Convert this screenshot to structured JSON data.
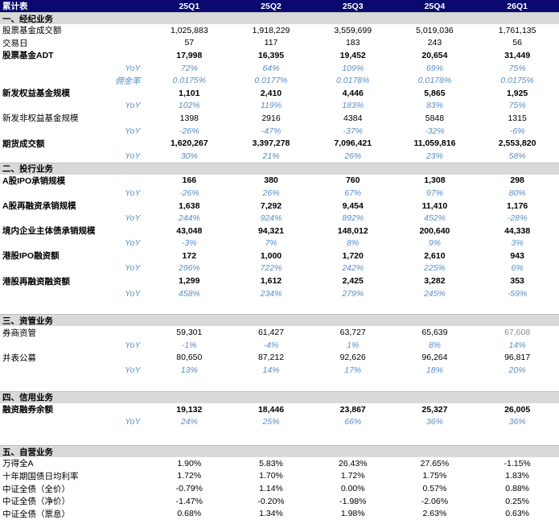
{
  "table": {
    "corner": "累计表",
    "quarters": [
      "25Q1",
      "25Q2",
      "25Q3",
      "25Q4",
      "26Q1"
    ]
  },
  "sections": [
    {
      "title": "一、经纪业务",
      "rows": [
        {
          "label": "股票基金成交额",
          "values": [
            "1,025,883",
            "1,918,229",
            "3,559,699",
            "5,019,036",
            "1,761,135"
          ],
          "style": "normal"
        },
        {
          "label": "交易日",
          "values": [
            "57",
            "117",
            "183",
            "243",
            "56"
          ],
          "style": "normal"
        },
        {
          "label": "股票基金ADT",
          "values": [
            "17,998",
            "16,395",
            "19,452",
            "20,654",
            "31,449"
          ],
          "style": "bold"
        },
        {
          "label": "YoY",
          "values": [
            "72%",
            "64%",
            "109%",
            "69%",
            "75%"
          ],
          "style": "sub"
        },
        {
          "label": "佣金率",
          "values": [
            "0.0175%",
            "0.0177%",
            "0.0178%",
            "0.0178%",
            "0.0175%"
          ],
          "style": "sub"
        },
        {
          "label": "新发权益基金规模",
          "values": [
            "1,101",
            "2,410",
            "4,446",
            "5,865",
            "1,925"
          ],
          "style": "bold"
        },
        {
          "label": "YoY",
          "values": [
            "102%",
            "119%",
            "183%",
            "83%",
            "75%"
          ],
          "style": "sub"
        },
        {
          "label": "新发非权益基金规模",
          "values": [
            "1398",
            "2916",
            "4384",
            "5848",
            "1315"
          ],
          "style": "normal"
        },
        {
          "label": "YoY",
          "values": [
            "-26%",
            "-47%",
            "-37%",
            "-32%",
            "-6%"
          ],
          "style": "sub"
        },
        {
          "label": "期货成交额",
          "values": [
            "1,620,267",
            "3,397,278",
            "7,096,421",
            "11,059,816",
            "2,553,820"
          ],
          "style": "bold"
        },
        {
          "label": "YoY",
          "values": [
            "30%",
            "21%",
            "26%",
            "23%",
            "58%"
          ],
          "style": "sub"
        }
      ]
    },
    {
      "title": "二、投行业务",
      "rows": [
        {
          "label": "A股IPO承销规模",
          "values": [
            "166",
            "380",
            "760",
            "1,308",
            "298"
          ],
          "style": "bold"
        },
        {
          "label": "YoY",
          "values": [
            "-26%",
            "26%",
            "67%",
            "97%",
            "80%"
          ],
          "style": "sub"
        },
        {
          "label": "A股再融资承销规模",
          "values": [
            "1,638",
            "7,292",
            "9,454",
            "11,410",
            "1,176"
          ],
          "style": "bold"
        },
        {
          "label": "YoY",
          "values": [
            "244%",
            "924%",
            "892%",
            "452%",
            "-28%"
          ],
          "style": "sub"
        },
        {
          "label": "境内企业主体债承销规模",
          "values": [
            "43,048",
            "94,321",
            "148,012",
            "200,640",
            "44,338"
          ],
          "style": "bold"
        },
        {
          "label": "YoY",
          "values": [
            "-3%",
            "7%",
            "8%",
            "9%",
            "3%"
          ],
          "style": "sub"
        },
        {
          "label": "港股IPO融资额",
          "values": [
            "172",
            "1,000",
            "1,720",
            "2,610",
            "943"
          ],
          "style": "bold"
        },
        {
          "label": "YoY",
          "values": [
            "296%",
            "722%",
            "242%",
            "225%",
            "6%"
          ],
          "style": "sub"
        },
        {
          "label": "港股再融资融资额",
          "values": [
            "1,299",
            "1,612",
            "2,425",
            "3,282",
            "353"
          ],
          "style": "bold"
        },
        {
          "label": "YoY",
          "values": [
            "458%",
            "234%",
            "279%",
            "245%",
            "-59%"
          ],
          "style": "sub"
        }
      ]
    },
    {
      "title": "三、资管业务",
      "rows": [
        {
          "label": "券商资管",
          "values": [
            "59,301",
            "61,427",
            "63,727",
            "65,639",
            "67,608"
          ],
          "style": "normal",
          "muted_last": true
        },
        {
          "label": "YoY",
          "values": [
            "-1%",
            "-4%",
            "1%",
            "8%",
            "14%"
          ],
          "style": "sub"
        },
        {
          "label": "并表公募",
          "values": [
            "80,650",
            "87,212",
            "92,626",
            "96,264",
            "96,817"
          ],
          "style": "normal"
        },
        {
          "label": "YoY",
          "values": [
            "13%",
            "14%",
            "17%",
            "18%",
            "20%"
          ],
          "style": "sub"
        }
      ]
    },
    {
      "title": "四、信用业务",
      "rows": [
        {
          "label": "融资融券余额",
          "values": [
            "19,132",
            "18,446",
            "23,867",
            "25,327",
            "26,005"
          ],
          "style": "bold"
        },
        {
          "label": "YoY",
          "values": [
            "24%",
            "25%",
            "66%",
            "36%",
            "36%"
          ],
          "style": "sub"
        }
      ]
    },
    {
      "title": "五、自营业务",
      "rows": [
        {
          "label": "万得全A",
          "values": [
            "1.90%",
            "5.83%",
            "26.43%",
            "27.65%",
            "-1.15%"
          ],
          "style": "normal"
        },
        {
          "label": "十年期国债日均利率",
          "values": [
            "1.72%",
            "1.70%",
            "1.72%",
            "1.75%",
            "1.83%"
          ],
          "style": "normal"
        },
        {
          "label": "中证全债（全价）",
          "values": [
            "-0.79%",
            "1.14%",
            "0.00%",
            "0.57%",
            "0.88%"
          ],
          "style": "normal"
        },
        {
          "label": "中证全债（净价）",
          "values": [
            "-1.47%",
            "-0.20%",
            "-1.98%",
            "-2.06%",
            "0.25%"
          ],
          "style": "normal"
        },
        {
          "label": "中证全债（票息）",
          "values": [
            "0.68%",
            "1.34%",
            "1.98%",
            "2.63%",
            "0.63%"
          ],
          "style": "normal"
        }
      ]
    }
  ]
}
